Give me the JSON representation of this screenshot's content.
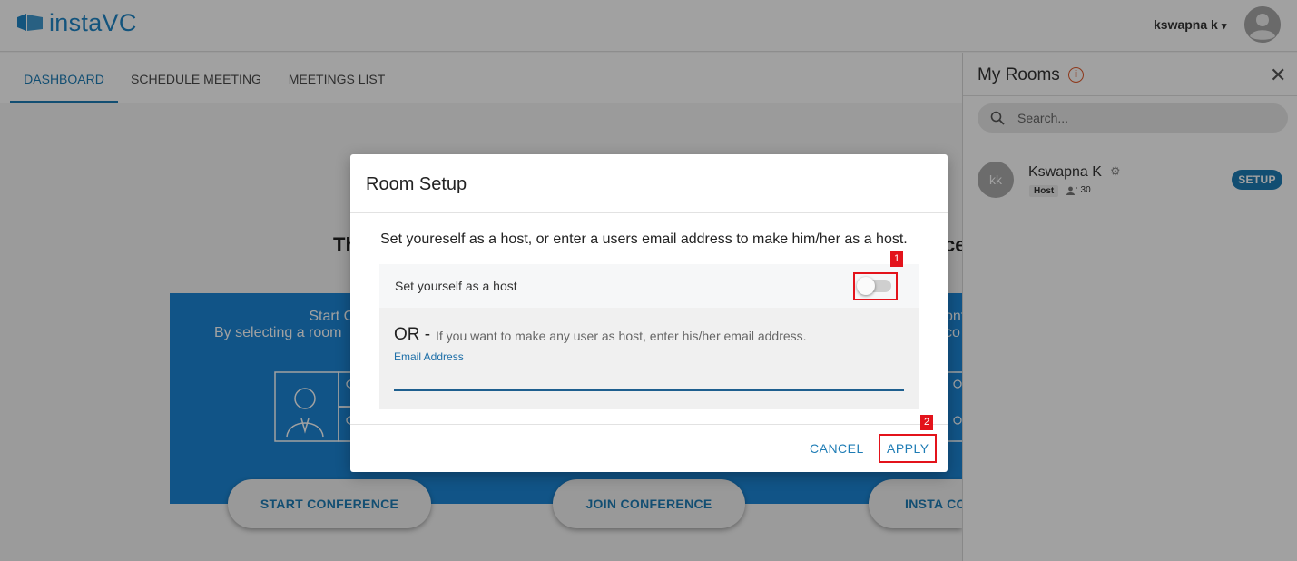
{
  "header": {
    "logo_text": "instaVC",
    "user_name": "kswapna k",
    "user_caret": "▾"
  },
  "nav": {
    "tabs": [
      {
        "label": "DASHBOARD",
        "active": true
      },
      {
        "label": "SCHEDULE MEETING",
        "active": false
      },
      {
        "label": "MEETINGS LIST",
        "active": false
      }
    ]
  },
  "main": {
    "heading_left_fragment": "Th",
    "heading_right_fragment": "ce",
    "cards": [
      {
        "title_line1": "Start Confer",
        "title_line2": "By selecting a room",
        "button": "START CONFERENCE"
      },
      {
        "button": "JOIN CONFERENCE"
      },
      {
        "title_line1": "onf",
        "title_line2": "co",
        "button": "INSTA CO"
      }
    ]
  },
  "rooms": {
    "title": "My Rooms",
    "info_icon": "info-icon",
    "close_icon": "✕",
    "search_placeholder": "Search...",
    "items": [
      {
        "avatar_initials": "kk",
        "name": "Kswapna K",
        "gear_icon": "⚙",
        "role": "Host",
        "capacity": ": 30",
        "action": "SETUP"
      }
    ]
  },
  "dialog": {
    "title": "Room Setup",
    "description": "Set youreself as a host, or enter a users email address to make him/her as a host.",
    "host_toggle_label": "Set yourself as a host",
    "host_toggle_on": false,
    "or_label": "OR -",
    "or_hint": "If you want to make any user as host, enter his/her email address.",
    "email_label": "Email Address",
    "email_value": "",
    "cancel_label": "CANCEL",
    "apply_label": "APPLY",
    "annotations": [
      "1",
      "2"
    ],
    "annotation_color": "#e3131b"
  },
  "colors": {
    "accent": "#1e7cb5",
    "brand": "#1f86c7",
    "card_blue": "#1b86d6"
  }
}
